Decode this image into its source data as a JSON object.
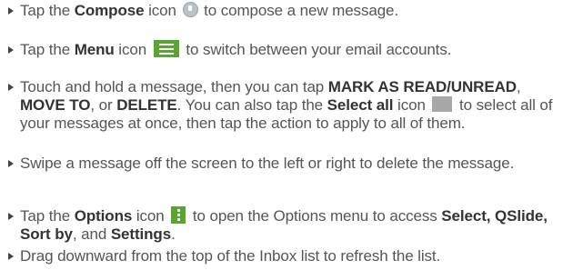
{
  "items": [
    {
      "parts": [
        "Tap the ",
        "Compose",
        " icon ",
        " to compose a new message."
      ],
      "icon": "compose-icon"
    },
    {
      "parts": [
        "Tap the ",
        "Menu",
        " icon ",
        " to switch between your email accounts."
      ],
      "icon": "menu-icon"
    },
    {
      "parts": [
        "Touch and hold a message, then you can tap ",
        "MARK AS READ/UNREAD",
        ", ",
        "MOVE TO",
        ", or ",
        "DELETE",
        ". You can also tap the ",
        "Select all",
        " icon ",
        " to select all of your messages at once, then tap the action to apply to all of them."
      ],
      "icon": "select-all-icon"
    },
    {
      "parts": [
        "Swipe a message off the screen to the left or right to delete the message."
      ]
    },
    {
      "parts": [
        "Tap the ",
        "Options",
        " icon ",
        " to open the Options menu to access ",
        "Select, QSlide, Sort by",
        ", and ",
        "Settings",
        "."
      ],
      "icon": "options-icon"
    },
    {
      "parts": [
        "Drag downward from the top of the Inbox list to refresh the list."
      ]
    }
  ],
  "colors": {
    "text": "#555555",
    "bold_text": "#333333",
    "accent_green": "#5aa532",
    "select_all_gray": "#a7a7a7"
  }
}
